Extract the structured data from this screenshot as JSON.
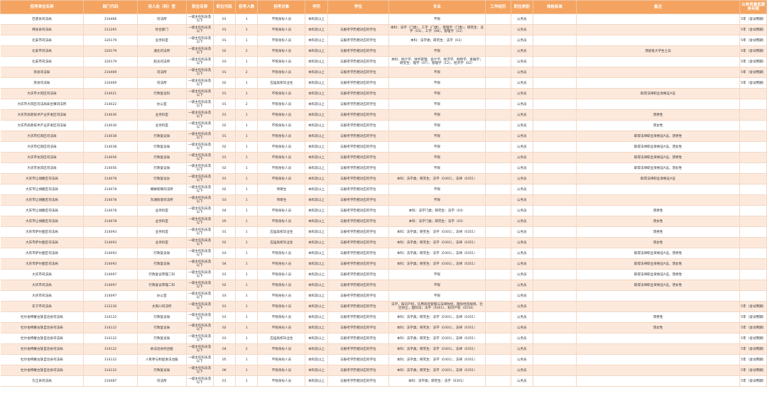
{
  "columns": [
    "招考单位名称",
    "部门代码",
    "用人处（科）室",
    "职位名称",
    "职位代码",
    "招考人数",
    "招考对象",
    "学历",
    "学位",
    "专业",
    "工作经历",
    "职位类别",
    "体检标准",
    "备注",
    "公务员最低服务年限"
  ],
  "rows": [
    [
      "巴彦县司法局",
      "310466",
      "司法所",
      "一级主任科员及以下",
      "01",
      "1",
      "不限身份人员",
      "本科及以上",
      "",
      "不限",
      "",
      "公务员",
      "",
      "",
      "5年（含试用期）"
    ],
    [
      "拜泉县司法局",
      "311265",
      "综合部门",
      "一级主任科员及以下",
      "01",
      "1",
      "不限身份人员",
      "本科及以上",
      "与报考学历相对应的学位",
      "本科：法学（门类），工学（门类），管理学（门类）；研究生：法学（03），工学（08），管理学（12）",
      "",
      "公务员",
      "",
      "",
      "5年（含试用期）"
    ],
    [
      "北安市司法局",
      "320179",
      "业务科室",
      "一级主任科员及以下",
      "01",
      "1",
      "不限身份人员",
      "本科及以上",
      "与报考学历相对应的学位",
      "本科：法学类；研究生：法学（03）",
      "",
      "公务员",
      "",
      "",
      "5年（含试用期）"
    ],
    [
      "北安市司法局",
      "320179",
      "通北司法所",
      "一级主任科员及以下",
      "02",
      "2",
      "不限身份人员",
      "本科及以上",
      "与报考学历相对应的学位",
      "不限",
      "",
      "公务员",
      "",
      "须退役大学生士兵",
      "5年（含试用期）"
    ],
    [
      "北安市司法局",
      "320179",
      "赵光司法所",
      "一级主任科员及以下",
      "03",
      "1",
      "不限身份人员",
      "本科及以上",
      "与报考学历相对应的学位",
      "本科：统计学、财务管理、会计学、经济学、财政学、金融学；研究生：理学（07）、管理学（12）、经济学（02）",
      "",
      "公务员",
      "",
      "",
      "5年（含试用期）"
    ],
    [
      "宾县司法局",
      "310469",
      "司法所",
      "一级主任科员及以下",
      "01",
      "2",
      "不限身份人员",
      "本科及以上",
      "与报考学历相对应的学位",
      "不限",
      "",
      "公务员",
      "",
      "",
      "5年（含试用期）"
    ],
    [
      "宾县司法局",
      "310469",
      "司法所",
      "一级主任科员及以下",
      "02",
      "1",
      "应届高校毕业生",
      "本科及以上",
      "与报考学历相对应的学位",
      "不限",
      "",
      "公务员",
      "",
      "",
      "5年（含试用期）"
    ],
    [
      "大庆市大同区司法局",
      "314021",
      "行政复议科",
      "一级主任科员及以下",
      "01",
      "1",
      "不限身份人员",
      "本科及以上",
      "与报考学历相对应的学位",
      "不限",
      "",
      "公务员",
      "",
      "取得法律职业资格证A证",
      ""
    ],
    [
      "大庆市大同区司法局高台镇司法所",
      "314022",
      "办公室",
      "一级主任科员及以下",
      "01",
      "2",
      "不限身份人员",
      "本科及以上",
      "与报考学历相对应的学位",
      "不限",
      "",
      "公务员",
      "",
      "",
      ""
    ],
    [
      "大庆市高新技术产业开发区司法局",
      "314030",
      "业务科室",
      "一级主任科员及以下",
      "01",
      "1",
      "不限身份人员",
      "本科及以上",
      "与报考学历相对应的学位",
      "不限",
      "",
      "公务员",
      "",
      "须男性",
      ""
    ],
    [
      "大庆市高新技术产业开发区司法局",
      "314030",
      "业务科室",
      "一级主任科员及以下",
      "02",
      "1",
      "不限身份人员",
      "本科及以上",
      "与报考学历相对应的学位",
      "不限",
      "",
      "公务员",
      "",
      "须女性",
      ""
    ],
    [
      "大庆市红岗区司法局",
      "314038",
      "行政复议局",
      "一级主任科员及以下",
      "01",
      "1",
      "不限身份人员",
      "本科及以上",
      "与报考学历相对应的学位",
      "不限",
      "",
      "公务员",
      "",
      "取得法律职业资格证A证，须男性",
      ""
    ],
    [
      "大庆市红岗区司法局",
      "314038",
      "行政复议局",
      "一级主任科员及以下",
      "02",
      "1",
      "不限身份人员",
      "本科及以上",
      "与报考学历相对应的学位",
      "不限",
      "",
      "公务员",
      "",
      "取得法律职业资格证A证，须女性",
      ""
    ],
    [
      "大庆市龙凤区司法局",
      "314056",
      "行政复议局",
      "一级主任科员及以下",
      "01",
      "1",
      "不限身份人员",
      "本科及以上",
      "与报考学历相对应的学位",
      "不限",
      "",
      "公务员",
      "",
      "取得法律职业资格证A证，须男性",
      ""
    ],
    [
      "大庆市龙凤区司法局",
      "314056",
      "行政复议局",
      "一级主任科员及以下",
      "02",
      "1",
      "不限身份人员",
      "本科及以上",
      "与报考学历相对应的学位",
      "不限",
      "",
      "公务员",
      "",
      "取得法律职业资格证A证，须女性",
      ""
    ],
    [
      "大庆市让胡路区司法局",
      "314078",
      "行政复议办",
      "一级主任科员及以下",
      "01",
      "1",
      "不限身份人员",
      "本科及以上",
      "与报考学历相对应的学位",
      "本科：法学类；研究生：法学（0301），法律（0351）",
      "",
      "公务员",
      "",
      "取得法律职业资格证A证",
      ""
    ],
    [
      "大庆市让胡路区司法局",
      "314078",
      "喇嘛甸镇司法所",
      "一级主任科员及以下",
      "02",
      "1",
      "项目生",
      "本科及以上",
      "与报考学历相对应的学位",
      "不限",
      "",
      "公务员",
      "",
      "",
      ""
    ],
    [
      "大庆市让胡路区司法局",
      "314078",
      "东湖街道司法所",
      "一级主任科员及以下",
      "03",
      "1",
      "项目生",
      "本科及以上",
      "与报考学历相对应的学位",
      "不限",
      "",
      "公务员",
      "",
      "",
      ""
    ],
    [
      "大庆市让胡路区司法局",
      "314078",
      "业务科室",
      "一级主任科员及以下",
      "04",
      "1",
      "不限身份人员",
      "本科及以上",
      "与报考学历相对应的学位",
      "本科：法学门类；研究生：法学（03）",
      "",
      "公务员",
      "",
      "须男性",
      ""
    ],
    [
      "大庆市让胡路区司法局",
      "314078",
      "业务科室",
      "一级主任科员及以下",
      "05",
      "1",
      "不限身份人员",
      "本科及以上",
      "与报考学历相对应的学位",
      "本科：法学门类；研究生：法学（03）",
      "",
      "公务员",
      "",
      "须女性",
      ""
    ],
    [
      "大庆市萨尔图区司法局",
      "314093",
      "业务科室",
      "一级主任科员及以下",
      "01",
      "1",
      "应届高校毕业生",
      "本科及以上",
      "与报考学历相对应的学位",
      "本科：法学类；研究生：法学（0301），法律（0351）",
      "",
      "公务员",
      "",
      "须男性",
      ""
    ],
    [
      "大庆市萨尔图区司法局",
      "314093",
      "业务科室",
      "一级主任科员及以下",
      "02",
      "1",
      "应届高校毕业生",
      "本科及以上",
      "与报考学历相对应的学位",
      "本科：法学类；研究生：法学（0301），法律（0351）",
      "",
      "公务员",
      "",
      "须女性",
      ""
    ],
    [
      "大庆市萨尔图区司法局",
      "314093",
      "行政复议局",
      "一级主任科员及以下",
      "03",
      "1",
      "不限身份人员",
      "本科及以上",
      "与报考学历相对应的学位",
      "本科：法学类；研究生：法学（0301），法律（0351）",
      "",
      "公务员",
      "",
      "取得法律职业资格证A证，须男性",
      ""
    ],
    [
      "大庆市萨尔图区司法局",
      "314093",
      "行政复议局",
      "一级主任科员及以下",
      "04",
      "1",
      "不限身份人员",
      "本科及以上",
      "与报考学历相对应的学位",
      "本科：法学类；研究生：法学（0301），法律（0351）",
      "",
      "公务员",
      "",
      "取得法律职业资格证A证，须女性",
      ""
    ],
    [
      "大庆市司法局",
      "314097",
      "行政复议审理二科",
      "一级主任科员及以下",
      "01",
      "1",
      "不限身份人员",
      "本科及以上",
      "与报考学历相对应的学位",
      "不限",
      "",
      "公务员",
      "",
      "取得法律职业资格证A证，须男性",
      ""
    ],
    [
      "大庆市司法局",
      "314097",
      "行政复议审理二科",
      "一级主任科员及以下",
      "02",
      "1",
      "不限身份人员",
      "本科及以上",
      "与报考学历相对应的学位",
      "不限",
      "",
      "公务员",
      "",
      "取得法律职业资格证A证，须女性",
      ""
    ],
    [
      "大庆市司法局",
      "314097",
      "办公室",
      "一级主任科员及以下",
      "03",
      "1",
      "不限身份人员",
      "本科及以上",
      "与报考学历相对应的学位",
      "不限",
      "",
      "公务员",
      "",
      "",
      ""
    ],
    [
      "东宁市司法局",
      "312230",
      "太阳川司法所",
      "一级主任科员及以下",
      "01",
      "1",
      "不限身份人员",
      "本科及以上",
      "与报考学历相对应的学位",
      "法学，知识产权，信用风险管理与法律防控，国际经贸规则，社区矫正，国际法；法学（0301），知识产权（0254）",
      "",
      "公务员",
      "",
      "",
      "5年（含试用期）"
    ],
    [
      "杜尔伯特蒙古族自治县司法局",
      "314122",
      "行政复议局",
      "一级主任科员及以下",
      "01",
      "1",
      "不限身份人员",
      "本科及以上",
      "与报考学历相对应的学位",
      "本科：法学类；研究生：法学（0301），法律（0351）",
      "",
      "公务员",
      "",
      "须男性",
      "5年（含试用期）"
    ],
    [
      "杜尔伯特蒙古族自治县司法局",
      "314122",
      "行政复议局",
      "一级主任科员及以下",
      "02",
      "1",
      "不限身份人员",
      "本科及以上",
      "与报考学历相对应的学位",
      "本科：法学类；研究生：法学（0301），法律（0351）",
      "",
      "公务员",
      "",
      "须女性",
      "5年（含试用期）"
    ],
    [
      "杜尔伯特蒙古族自治县司法局",
      "314122",
      "行政复议局",
      "一级主任科员及以下",
      "03",
      "1",
      "应届高校毕业生",
      "本科及以上",
      "与报考学历相对应的学位",
      "本科：法学类；研究生：法学（0301），法律（0351）",
      "",
      "公务员",
      "",
      "",
      "5年（含试用期）"
    ],
    [
      "杜尔伯特蒙古族自治县司法局",
      "314122",
      "依法治县综合股",
      "一级主任科员及以下",
      "04",
      "2",
      "不限身份人员",
      "本科及以上",
      "与报考学历相对应的学位",
      "本科：法学类；研究生：法学（0301），法律（0351）",
      "",
      "公务员",
      "",
      "",
      "5年（含试用期）"
    ],
    [
      "杜尔伯特蒙古族自治县司法局",
      "314122",
      "人民参与和促进法治股",
      "一级主任科员及以下",
      "05",
      "1",
      "不限身份人员",
      "本科及以上",
      "与报考学历相对应的学位",
      "本科：法学类；研究生：法学（0301），法律（0351）",
      "",
      "公务员",
      "",
      "",
      "5年（含试用期）"
    ],
    [
      "杜尔伯特蒙古族自治县司法局",
      "314122",
      "行政复议局",
      "一级主任科员及以下",
      "06",
      "1",
      "不限身份人员",
      "本科及以上",
      "与报考学历相对应的学位",
      "本科：法学类；研究生：法学（0301），法律（0351）",
      "",
      "公务员",
      "",
      "",
      "5年（含试用期）"
    ],
    [
      "方正县司法局",
      "310487",
      "司法所",
      "一级主任科员及以下",
      "01",
      "1",
      "不限身份人员",
      "本科及以上",
      "与报考学历相对应的学位",
      "本科：法学类；研究生：法学（0301）",
      "",
      "公务员",
      "",
      "",
      "5年（含试用期）"
    ]
  ]
}
